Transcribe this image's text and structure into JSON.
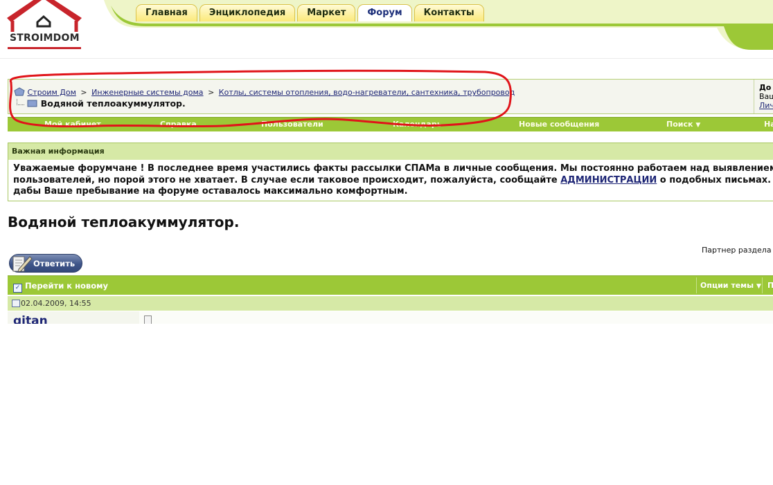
{
  "logo": {
    "text": "STROIMDOM"
  },
  "tabs": [
    {
      "label": "Главная"
    },
    {
      "label": "Энциклопедия"
    },
    {
      "label": "Маркет"
    },
    {
      "label": "Форум"
    },
    {
      "label": "Контакты"
    }
  ],
  "active_tab": "Форум",
  "breadcrumb": {
    "items": [
      "Строим Дом",
      "Инженерные системы дома",
      "Котлы, системы отопления, водо-нагреватели, сантехника, трубопровод"
    ],
    "separator": ">",
    "current": "Водяной теплоакуммулятор."
  },
  "welcome": {
    "line1": "До",
    "line2": "Ваш",
    "line3": "Лич"
  },
  "navbar": {
    "items": [
      "Мой кабинет",
      "Справка",
      "Пользователи",
      "Календарь",
      "Новые сообщения",
      "Поиск",
      "На"
    ]
  },
  "notice": {
    "title": "Важная информация",
    "line1": "Уважаемые форумчане ! В последнее время участились факты рассылки СПАМа в личные сообщения. Мы постоянно работаем над выявлением",
    "line2_before": "пользователей, но порой этого не хватает. В случае если таковое происходит, пожалуйста, сообщайте ",
    "line2_link": "АДМИНИСТРАЦИИ",
    "line2_after": " о подобных письмах. М",
    "line3": "дабы Ваше пребывание на форуме оставалось максимально комфортным."
  },
  "thread": {
    "title": "Водяной теплоакуммулятор.",
    "partner_label": "Партнер раздела",
    "reply_label": "Ответить",
    "goto_new": "Перейти к новому",
    "options": "Опции темы",
    "options_more": "П"
  },
  "post": {
    "date": "02.04.2009, 14:55",
    "username": "gitan"
  },
  "colors": {
    "brand_green": "#9cc837",
    "light_green": "#d6e9a6",
    "tab_yellow": "#fbe97a",
    "logo_red": "#c8242b",
    "link_blue": "#1d2575",
    "annotation_red": "#e0141a"
  }
}
